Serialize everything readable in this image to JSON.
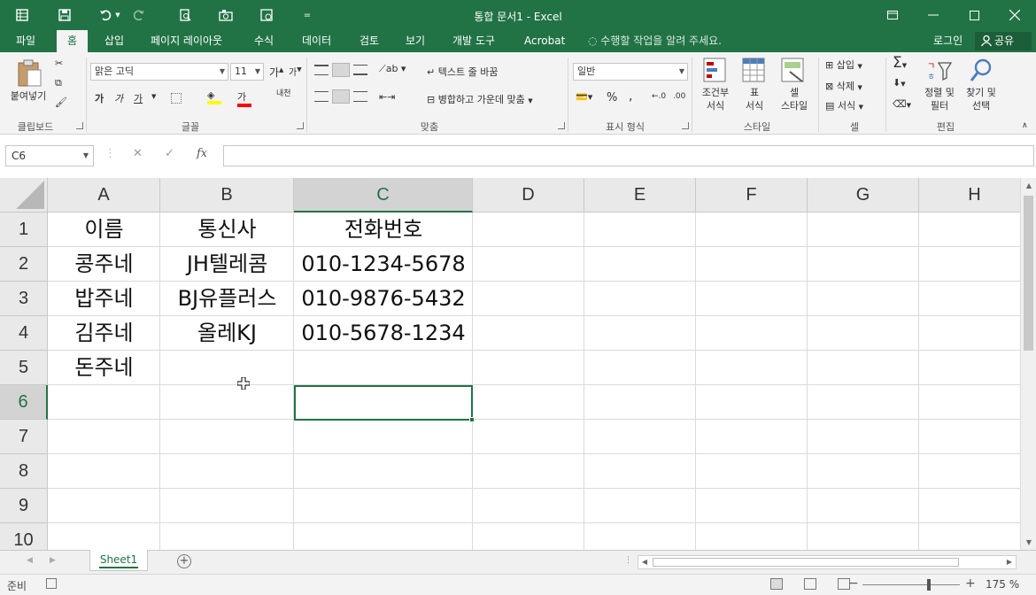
{
  "titlebar": {
    "title": "통합 문서1 - Excel",
    "qat_customize": "="
  },
  "tabs": [
    "파일",
    "홈",
    "삽입",
    "페이지 레이아웃",
    "수식",
    "데이터",
    "검토",
    "보기",
    "개발 도구",
    "Acrobat"
  ],
  "tell_me": "수행할 작업을 알려 주세요.",
  "account": {
    "signin": "로그인",
    "share": "공유"
  },
  "ribbon": {
    "clipboard": {
      "label": "클립보드",
      "paste": "붙여넣기"
    },
    "font": {
      "label": "글꼴",
      "name": "맑은 고딕",
      "size": "11",
      "bold": "가",
      "italic": "가",
      "underline": "가",
      "grow": "가",
      "shrink": "가",
      "phonetic": "내천",
      "color_letter": "가"
    },
    "alignment": {
      "label": "맞춤",
      "wrap": "텍스트 줄 바꿈",
      "merge": "병합하고 가운데 맞춤"
    },
    "number": {
      "label": "표시 형식",
      "format": "일반",
      "percent": "%",
      "comma": ",",
      "inc_dec": "←.0",
      "dec_dec": ".00"
    },
    "styles": {
      "label": "스타일",
      "conditional": "조건부\n서식",
      "table": "표\n서식",
      "cell": "셀\n스타일"
    },
    "cells": {
      "label": "셀",
      "insert": "삽입",
      "delete": "삭제",
      "format": "서식"
    },
    "editing": {
      "label": "편집",
      "sort": "정렬 및\n필터",
      "find": "찾기 및\n선택"
    }
  },
  "formula_bar": {
    "name_box": "C6",
    "cancel": "✕",
    "enter": "✓",
    "fx": "fx",
    "value": ""
  },
  "sheet": {
    "columns": [
      "A",
      "B",
      "C",
      "D",
      "E",
      "F",
      "G",
      "H"
    ],
    "rows": [
      "1",
      "2",
      "3",
      "4",
      "5",
      "6",
      "7",
      "8",
      "9",
      "10"
    ],
    "selected_cell": "C6",
    "cells": [
      [
        "이름",
        "통신사",
        "전화번호"
      ],
      [
        "콩주네",
        "JH텔레콤",
        "010-1234-5678"
      ],
      [
        "밥주네",
        "BJ유플러스",
        "010-9876-5432"
      ],
      [
        "김주네",
        "올레KJ",
        "010-5678-1234"
      ],
      [
        "돈주네",
        "",
        ""
      ]
    ]
  },
  "sheet_tabs": {
    "active": "Sheet1",
    "add": "+"
  },
  "status": {
    "mode": "준비",
    "zoom": "175 %"
  },
  "colors": {
    "accent": "#217346",
    "ribbon_bg": "#f3f3f3"
  }
}
